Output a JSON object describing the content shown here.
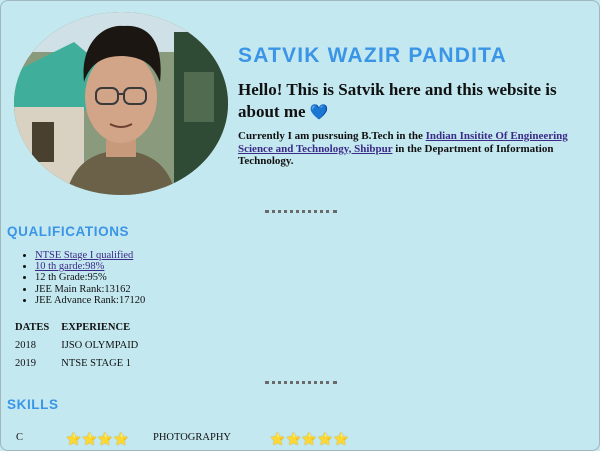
{
  "profile": {
    "name": "SATVIK WAZIR PANDITA",
    "hello": "Hello! This is Satvik here and this website is about me",
    "heart_icon": "blue-heart-emoji",
    "current_prefix": "Currently I am pusrsuing B.Tech in the",
    "institute_link": "Indian Insitite Of Engineering Science and Technology, Shibpur",
    "current_suffix": "in the Department of Information Technology."
  },
  "qualifications": {
    "title": "QUALIFICATIONS",
    "items": [
      {
        "text": "NTSE Stage I qualified",
        "link": true
      },
      {
        "text": "10 th garde:98%",
        "link": true
      },
      {
        "text": "12 th Grade:95%",
        "link": false
      },
      {
        "text": "JEE Main Rank:13162",
        "link": false
      },
      {
        "text": "JEE Advance Rank:17120",
        "link": false
      }
    ]
  },
  "experience": {
    "headers": [
      "DATES",
      "EXPERIENCE"
    ],
    "rows": [
      [
        "2018",
        "IJSO OLYMPAID"
      ],
      [
        "2019",
        "NTSE STAGE 1"
      ]
    ]
  },
  "skills": {
    "title": "SKILLS",
    "items": [
      {
        "name": "C",
        "stars": "⭐⭐⭐⭐",
        "rating": 4
      },
      {
        "name": "PHOTOGRAPHY",
        "stars": "⭐⭐⭐⭐⭐",
        "rating": 5
      }
    ]
  },
  "colors": {
    "background": "#c3e8f0",
    "heading": "#3b95e6",
    "link": "#3b2a87"
  }
}
